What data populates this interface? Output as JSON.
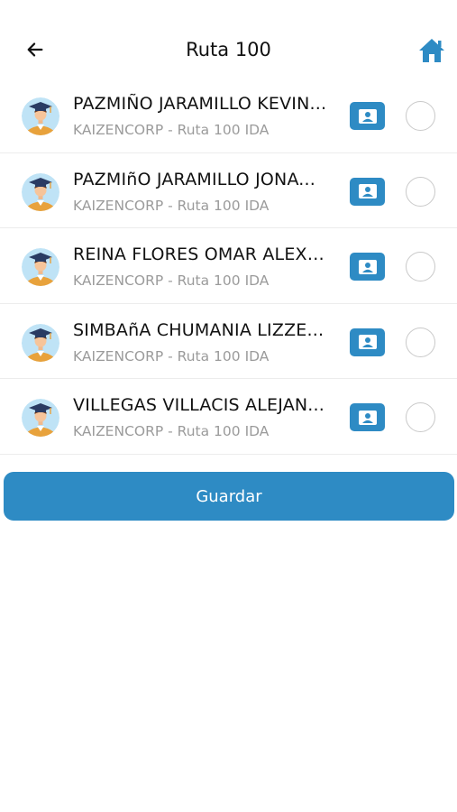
{
  "header": {
    "title": "Ruta 100",
    "back_icon": "arrow-left-icon",
    "home_icon": "home-icon",
    "accent_color": "#2e8bc4"
  },
  "students": [
    {
      "name": "PAZMIÑO JARAMILLO KEVIN...",
      "route": "KAIZENCORP - Ruta 100 IDA",
      "selected": false
    },
    {
      "name": "PAZMIñO JARAMILLO JONA...",
      "route": "KAIZENCORP - Ruta 100 IDA",
      "selected": false
    },
    {
      "name": "REINA FLORES OMAR ALEXA...",
      "route": "KAIZENCORP - Ruta 100 IDA",
      "selected": false
    },
    {
      "name": "SIMBAñA CHUMANIA LIZZE...",
      "route": "KAIZENCORP - Ruta 100 IDA",
      "selected": false
    },
    {
      "name": "VILLEGAS VILLACIS ALEJAN...",
      "route": "KAIZENCORP - Ruta 100 IDA",
      "selected": false
    }
  ],
  "row_icons": {
    "avatar": "graduate-avatar-icon",
    "card": "contact-card-icon"
  },
  "actions": {
    "save_label": "Guardar"
  }
}
